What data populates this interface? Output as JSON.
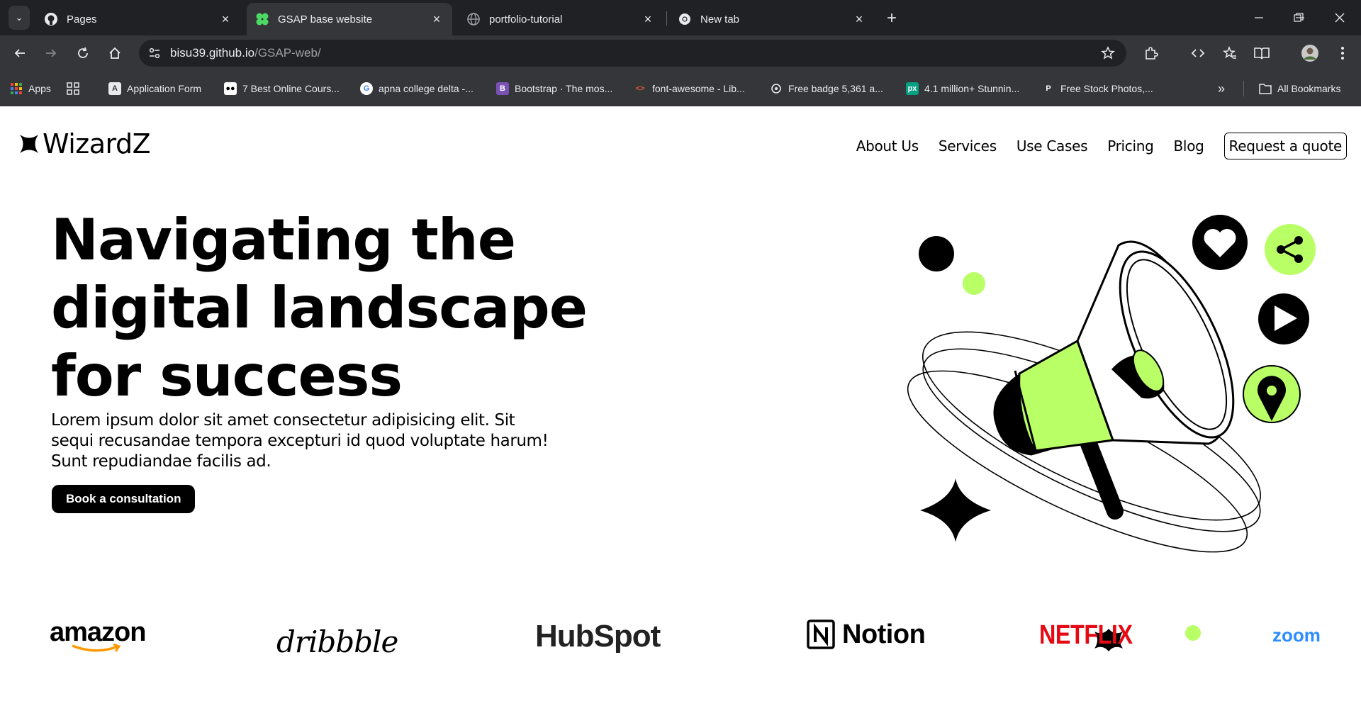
{
  "browser": {
    "tabs": [
      {
        "title": "Pages",
        "favicon": "github-icon",
        "active": false
      },
      {
        "title": "GSAP base website",
        "favicon": "gsap-icon",
        "active": true
      },
      {
        "title": "portfolio-tutorial",
        "favicon": "globe-icon",
        "active": false
      },
      {
        "title": "New tab",
        "favicon": "chrome-icon",
        "active": false
      }
    ],
    "url_host": "bisu39.github.io",
    "url_path": "/GSAP-web/",
    "bookmarks": [
      {
        "label": "Apps",
        "icon": "apps-grid-icon"
      },
      {
        "label": "Application Form",
        "icon": "form-icon"
      },
      {
        "label": "7 Best Online Cours...",
        "icon": "medium-icon"
      },
      {
        "label": "apna college delta -...",
        "icon": "google-icon"
      },
      {
        "label": "Bootstrap · The mos...",
        "icon": "bootstrap-icon"
      },
      {
        "label": "font-awesome - Lib...",
        "icon": "code-icon"
      },
      {
        "label": "Free badge 5,361 a...",
        "icon": "badge-icon"
      },
      {
        "label": "4.1 million+ Stunnin...",
        "icon": "pexels-icon"
      },
      {
        "label": "Free Stock Photos,...",
        "icon": "pixabay-icon"
      }
    ],
    "all_bookmarks": "All Bookmarks",
    "colors": {
      "tabbar": "#202124",
      "toolbar": "#35363a",
      "text": "#e8eaed"
    }
  },
  "site": {
    "logo": "WizardZ",
    "nav": [
      "About Us",
      "Services",
      "Use Cases",
      "Pricing",
      "Blog"
    ],
    "quote_button": "Request a quote",
    "hero": {
      "title_lines": [
        "Navigating the",
        "digital landscape",
        "for success"
      ],
      "subtitle": "Lorem ipsum dolor sit amet consectetur adipisicing elit. Sit sequi recusandae tempora excepturi id quod voluptate harum! Sunt repudiandae facilis ad.",
      "cta": "Book a consultation"
    },
    "brands": [
      "amazon",
      "dribbble",
      "HubSpot",
      "Notion",
      "NETFLIX",
      "zoom"
    ],
    "colors": {
      "accent": "#b9ff66",
      "text": "#000000",
      "netflix": "#e50914",
      "zoom": "#2d8cff",
      "amazon_arrow": "#ff9900"
    }
  }
}
